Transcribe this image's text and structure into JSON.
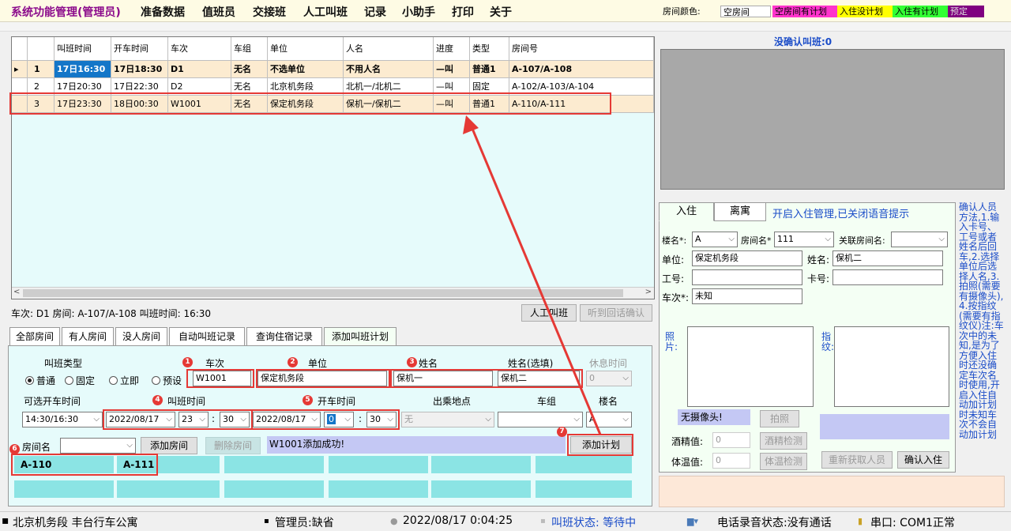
{
  "menu": {
    "items": [
      "系统功能管理(管理员)",
      "准备数据",
      "值班员",
      "交接班",
      "人工叫班",
      "记录",
      "小助手",
      "打印",
      "关于"
    ]
  },
  "room_colors": {
    "label": "房间颜色:",
    "legend": [
      {
        "text": "空房间",
        "color": "#ffffff"
      },
      {
        "text": "空房间有计划",
        "color": "#ff33cc"
      },
      {
        "text": "入住没计划",
        "color": "#ffff00"
      },
      {
        "text": "入住有计划",
        "color": "#33ff33"
      },
      {
        "text": "预定",
        "color": "#800080"
      }
    ]
  },
  "grid": {
    "headers": [
      "叫班时间",
      "开车时间",
      "车次",
      "车组",
      "单位",
      "人名",
      "进度",
      "类型",
      "房间号"
    ],
    "rows": [
      {
        "marker": "▸",
        "no": "1",
        "call_time": "17日16:30",
        "depart_time": "17日18:30",
        "train": "D1",
        "group": "无名",
        "unit": "不选单位",
        "person": "不用人名",
        "progress": "—叫",
        "type": "普通1",
        "room": "A-107/A-108"
      },
      {
        "marker": "",
        "no": "2",
        "call_time": "17日20:30",
        "depart_time": "17日22:30",
        "train": "D2",
        "group": "无名",
        "unit": "北京机务段",
        "person": "北机一/北机二",
        "progress": "—叫",
        "type": "固定",
        "room": "A-102/A-103/A-104"
      },
      {
        "marker": "",
        "no": "3",
        "call_time": "17日23:30",
        "depart_time": "18日00:30",
        "train": "W1001",
        "group": "无名",
        "unit": "保定机务段",
        "person": "保机一/保机二",
        "progress": "—叫",
        "type": "普通1",
        "room": "A-110/A-111"
      }
    ]
  },
  "info_line": "车次: D1 房间: A-107/A-108   叫班时间: 16:30",
  "buttons": {
    "manual_call": "人工叫班",
    "confirm_callback": "听到回话确认",
    "add_room": "添加房间",
    "delete_room": "删除房间",
    "add_plan": "添加计划",
    "photo": "拍照",
    "alcohol_check": "酒精检测",
    "temp_check": "体温检测",
    "refetch": "重新获取人员",
    "confirm_checkin": "确认入住"
  },
  "tabs": [
    "全部房间",
    "有人房间",
    "没人房间",
    "自动叫班记录",
    "查询住宿记录",
    "添加叫班计划"
  ],
  "form": {
    "call_type_label": "叫班类型",
    "radios": [
      "普通",
      "固定",
      "立即",
      "预设"
    ],
    "train_label": "车次",
    "train_value": "W1001",
    "unit_label": "单位",
    "unit_value": "保定机务段",
    "name_label": "姓名",
    "name_value": "保机一",
    "name2_label": "姓名(选填)",
    "name2_value": "保机二",
    "rest_label": "休息时间",
    "rest_value": "0",
    "optional_label": "可选开车时间",
    "optional_value": "14:30/16:30",
    "call_time_label": "叫班时间",
    "call_date": "2022/08/17",
    "call_hour": "23",
    "call_min": "30",
    "depart_label": "开车时间",
    "depart_date": "2022/08/17",
    "depart_hour": "0",
    "depart_min": "30",
    "boarding_label": "出乘地点",
    "boarding_value": "无",
    "group_label": "车组",
    "group_value": "",
    "building_label": "楼名",
    "building_value": "A",
    "room_label": "房间名",
    "room_value": "",
    "success_msg": "W1001添加成功!",
    "rooms": [
      "A-110",
      "A-111",
      "",
      "",
      "",
      ""
    ]
  },
  "badges": [
    "1",
    "2",
    "3",
    "4",
    "5",
    "6",
    "7"
  ],
  "unconfirmed": "没确认叫班:0",
  "checkin": {
    "tabs": [
      "入住",
      "离寓"
    ],
    "voice_notice": "开启入住管理,已关闭语音提示",
    "building_label": "楼名*:",
    "building_value": "A",
    "room_label": "房间名*",
    "room_value": "111",
    "related_label": "关联房间名:",
    "related_value": "",
    "unit_label": "单位:",
    "unit_value": "保定机务段",
    "name_label": "姓名:",
    "name_value": "保机二",
    "workno_label": "工号:",
    "workno_value": "",
    "card_label": "卡号:",
    "card_value": "",
    "train_label": "车次*:",
    "train_value": "未知",
    "photo_label": "照片:",
    "finger_label": "指纹:",
    "no_camera": "无摄像头!",
    "alcohol_label": "酒精值:",
    "alcohol_value": "0",
    "temp_label": "体温值:",
    "temp_value": "0"
  },
  "help_text": "确认人员方法,1.输入卡号、工号或者姓名后回车,2.选择单位后选择人名,3.拍照(需要有摄像头),4.按指纹(需要有指纹仪)注:车次中的未知,是为了方便入住时还没确定车次名时使用,开启入住自动加计划时未知车次不会自动加计划",
  "status": {
    "org": "北京机务段 丰台行车公寓",
    "admin": "管理员:缺省",
    "datetime": "2022/08/17 0:04:25",
    "call_status": "叫班状态: 等待中",
    "phone_status": "电话录音状态:没有通话",
    "serial": "串口: COM1正常"
  }
}
